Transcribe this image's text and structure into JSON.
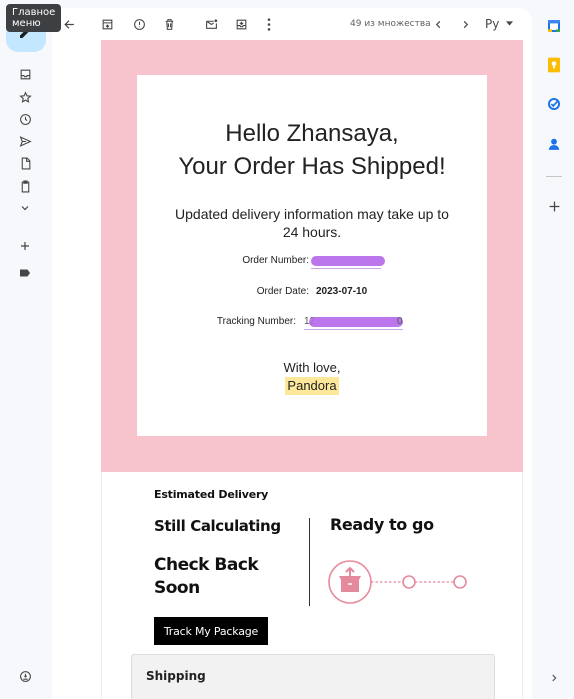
{
  "tooltip": "Главное меню",
  "toolbar": {
    "count": "49 из множества",
    "lang": "Ру"
  },
  "email": {
    "greeting_line1": "Hello Zhansaya,",
    "greeting_line2": "Your Order Has Shipped!",
    "subtitle": "Updated delivery information may take up to 24 hours.",
    "order_number_label": "Order Number:",
    "order_date_label": "Order Date:",
    "order_date_value": "2023-07-10",
    "tracking_number_label": "Tracking Number:",
    "tracking_prefix": "12",
    "tracking_suffix": "0",
    "signoff": "With love,",
    "brand": "Pandora",
    "estimated_delivery": "Estimated Delivery",
    "still_calculating": "Still Calculating",
    "check_back": "Check Back Soon",
    "ready_to_go": "Ready to go",
    "track_button": "Track My Package",
    "shipping_header": "Shipping"
  },
  "colors": {
    "pink_background": "#f7c3cd",
    "compose": "#c2e7ff",
    "progress": "#e58a9c",
    "highlight": "#fde89a"
  },
  "icons": {
    "left_rail": [
      "pencil-icon",
      "inbox-icon",
      "star-icon",
      "clock-icon",
      "send-icon",
      "file-icon",
      "clipboard-icon",
      "chevron-down-icon",
      "plus-icon",
      "label-icon",
      "support-icon"
    ],
    "toolbar": [
      "arrow-back-icon",
      "archive-icon",
      "report-spam-icon",
      "delete-icon",
      "mark-unread-icon",
      "move-to-icon",
      "more-vert-icon",
      "chevron-left-icon",
      "chevron-right-icon",
      "caret-down-icon"
    ],
    "right_rail": [
      "calendar-icon",
      "keep-icon",
      "tasks-icon",
      "contacts-icon",
      "plus-icon",
      "chevron-right-icon"
    ]
  }
}
